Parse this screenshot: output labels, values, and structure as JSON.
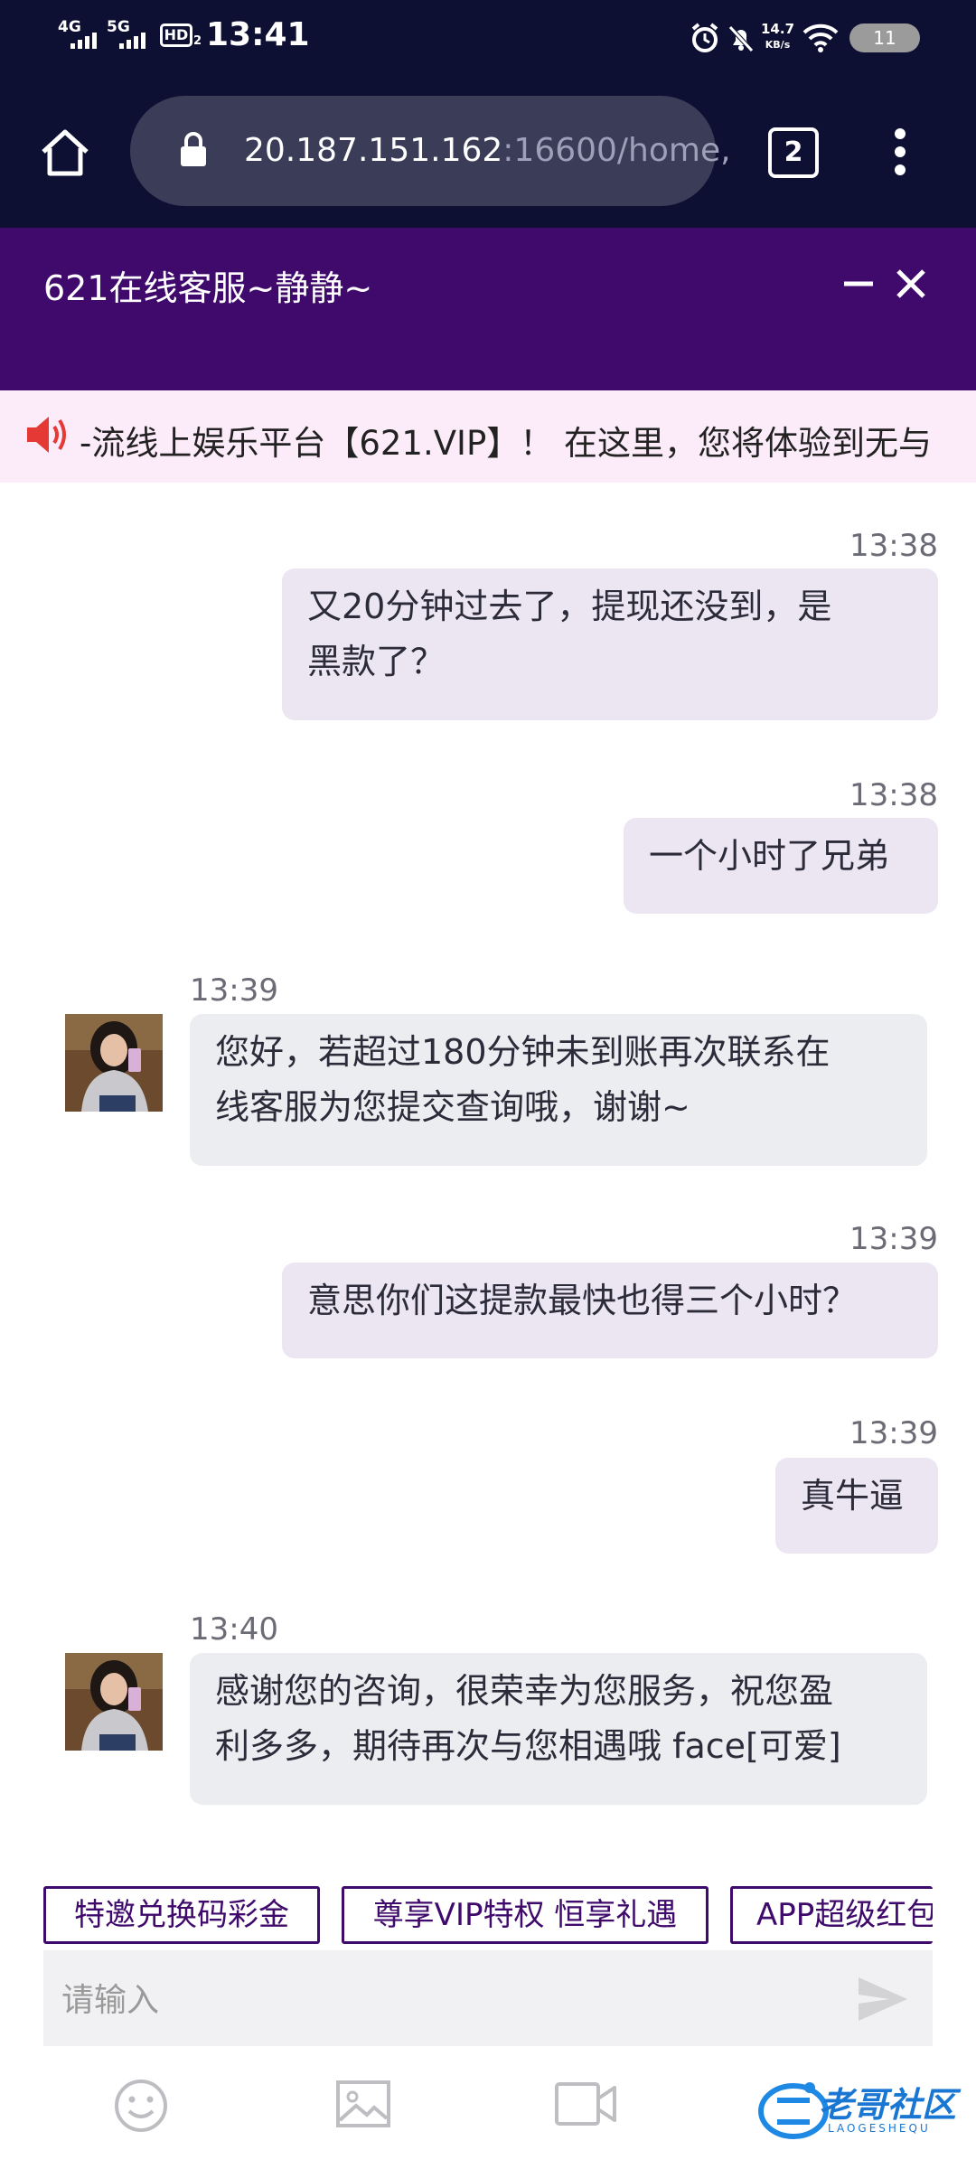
{
  "status_bar": {
    "net1": "4G",
    "net2": "5G",
    "hd": "HD",
    "hd_sub": "2",
    "time": "13:41",
    "speed_value": "14.7",
    "speed_unit": "KB/s",
    "battery": "11"
  },
  "browser": {
    "url_host": "20.187.151.162",
    "url_path": ":16600/home,",
    "tab_count": "2"
  },
  "chat_header": {
    "title": "621在线客服~静静~"
  },
  "marquee": {
    "text": "-流线上娱乐平台【621.VIP】！ 在这里，您将体验到无与"
  },
  "messages": [
    {
      "from": "me",
      "time": "13:38",
      "lines": [
        "又20分钟过去了，提现还没到，是",
        "黑款了？"
      ]
    },
    {
      "from": "me",
      "time": "13:38",
      "lines": [
        "一个小时了兄弟"
      ]
    },
    {
      "from": "agent",
      "time": "13:39",
      "lines": [
        "您好，若超过180分钟未到账再次联系在",
        "线客服为您提交查询哦，谢谢~"
      ]
    },
    {
      "from": "me",
      "time": "13:39",
      "lines": [
        "意思你们这提款最快也得三个小时？"
      ]
    },
    {
      "from": "me",
      "time": "13:39",
      "lines": [
        "真牛逼"
      ]
    },
    {
      "from": "agent",
      "time": "13:40",
      "lines": [
        "感谢您的咨询，很荣幸为您服务，祝您盈",
        "利多多，期待再次与您相遇哦 face[可爱]"
      ]
    }
  ],
  "quick_replies": [
    "特邀兑换码彩金",
    "尊享VIP特权 恒享礼遇",
    "APP超级红包"
  ],
  "input": {
    "placeholder": "请输入"
  },
  "watermark": {
    "text": "老哥社区",
    "sub": "LAOGESHEQU"
  },
  "colors": {
    "status_bg": "#0e1033",
    "header_purple": "#3f0a6b",
    "marquee_bg": "#fcecf9",
    "my_bubble": "#ece6f3",
    "agent_bubble": "#ecedf0"
  }
}
